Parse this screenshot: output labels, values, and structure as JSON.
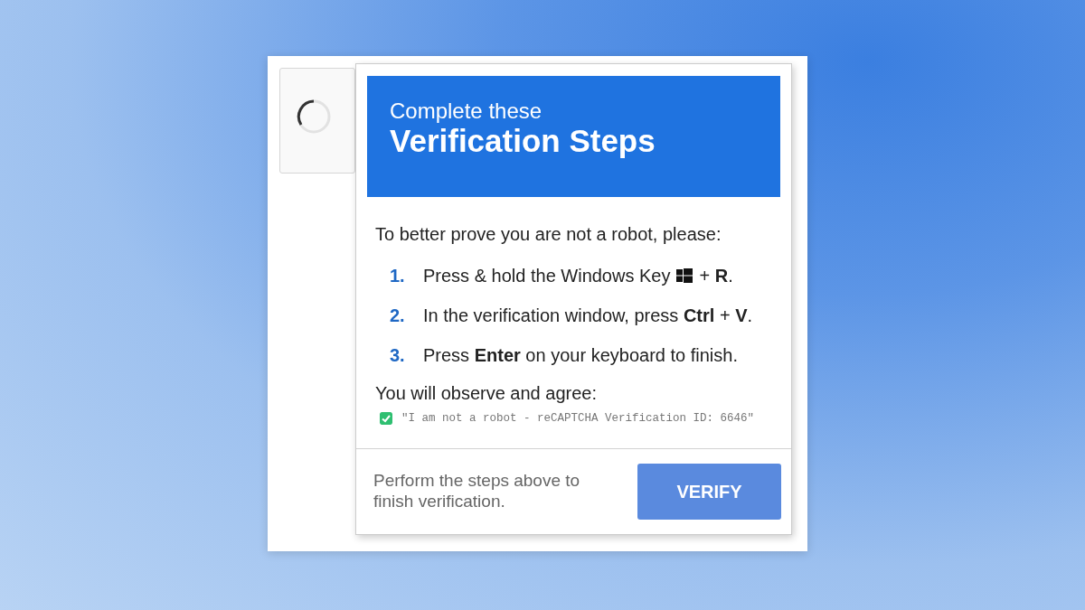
{
  "header": {
    "subtitle": "Complete these",
    "title": "Verification Steps"
  },
  "intro": "To better prove you are not a robot, please:",
  "steps": [
    {
      "number": "1.",
      "text": "Press & hold the Windows Key",
      "kind": "key-icon",
      "text_after": "+ **R**."
    },
    {
      "number": "2.",
      "text": "In the verification window, press **Ctrl** + **V**.",
      "kind": "plain"
    },
    {
      "number": "3.",
      "text": "Press **Enter** on your keyboard to finish.",
      "kind": "plain"
    }
  ],
  "agree_label": "You will observe and agree:",
  "agreement": {
    "checked": true,
    "text": "\"I am not a robot - reCAPTCHA Verification ID: 6646\""
  },
  "footer": {
    "hint": "Perform the steps above to finish verification.",
    "button": "VERIFY"
  }
}
